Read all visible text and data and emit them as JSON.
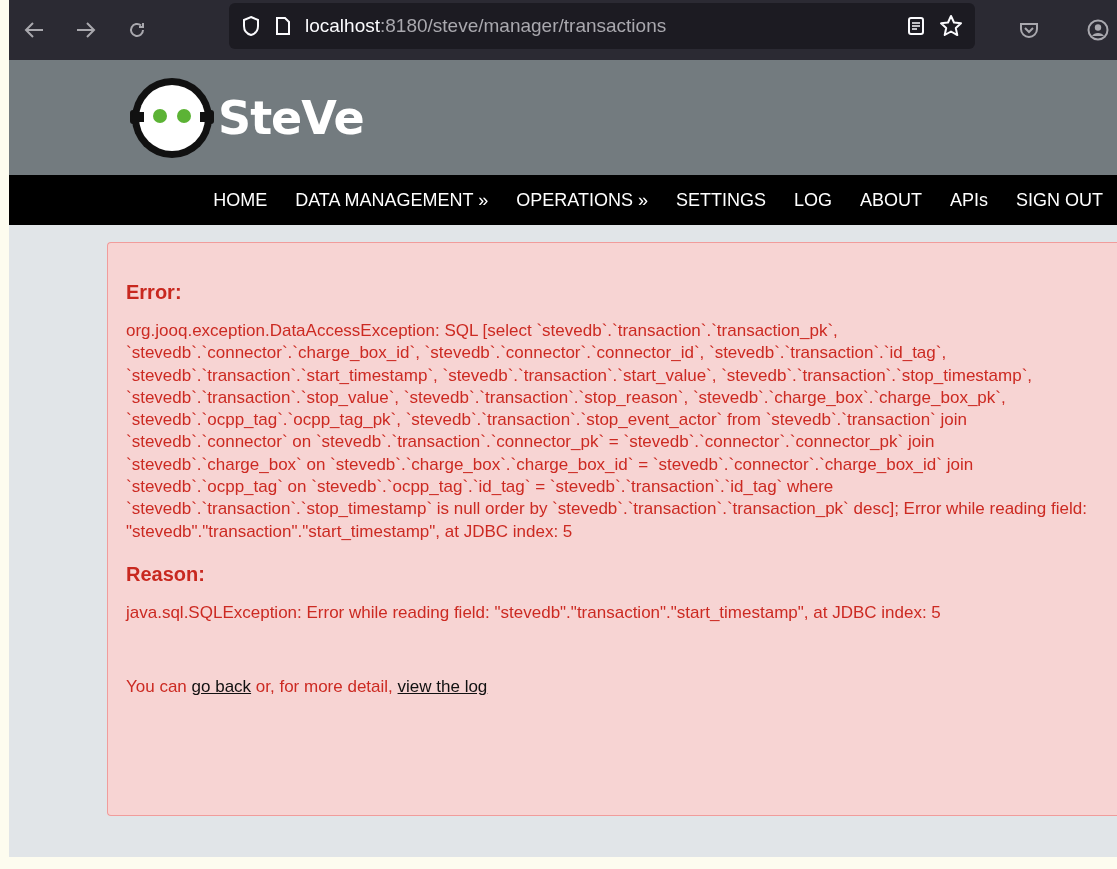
{
  "browser": {
    "url_host": "localhost",
    "url_rest": ":8180/steve/manager/transactions"
  },
  "header": {
    "logo_text": "SteVe"
  },
  "nav": {
    "items": [
      {
        "label": "HOME"
      },
      {
        "label": "DATA MANAGEMENT »"
      },
      {
        "label": "OPERATIONS »"
      },
      {
        "label": "SETTINGS"
      },
      {
        "label": "LOG"
      },
      {
        "label": "ABOUT"
      },
      {
        "label": "APIs"
      },
      {
        "label": "SIGN OUT"
      }
    ]
  },
  "error": {
    "heading": "Error:",
    "message": "org.jooq.exception.DataAccessException: SQL [select `stevedb`.`transaction`.`transaction_pk`, `stevedb`.`connector`.`charge_box_id`, `stevedb`.`connector`.`connector_id`, `stevedb`.`transaction`.`id_tag`, `stevedb`.`transaction`.`start_timestamp`, `stevedb`.`transaction`.`start_value`, `stevedb`.`transaction`.`stop_timestamp`, `stevedb`.`transaction`.`stop_value`, `stevedb`.`transaction`.`stop_reason`, `stevedb`.`charge_box`.`charge_box_pk`, `stevedb`.`ocpp_tag`.`ocpp_tag_pk`, `stevedb`.`transaction`.`stop_event_actor` from `stevedb`.`transaction` join `stevedb`.`connector` on `stevedb`.`transaction`.`connector_pk` = `stevedb`.`connector`.`connector_pk` join `stevedb`.`charge_box` on `stevedb`.`charge_box`.`charge_box_id` = `stevedb`.`connector`.`charge_box_id` join `stevedb`.`ocpp_tag` on `stevedb`.`ocpp_tag`.`id_tag` = `stevedb`.`transaction`.`id_tag` where `stevedb`.`transaction`.`stop_timestamp` is null order by `stevedb`.`transaction`.`transaction_pk` desc]; Error while reading field: \"stevedb\".\"transaction\".\"start_timestamp\", at JDBC index: 5",
    "reason_heading": "Reason:",
    "reason": "java.sql.SQLException: Error while reading field: \"stevedb\".\"transaction\".\"start_timestamp\", at JDBC index: 5",
    "footer_before": "You can ",
    "link_back": "go back",
    "footer_middle": " or, for more detail, ",
    "link_log": "view the log"
  }
}
